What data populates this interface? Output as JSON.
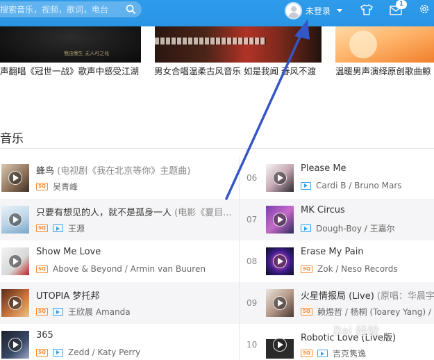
{
  "search": {
    "placeholder": "搜索音乐，视频，歌词，电台"
  },
  "user": {
    "login_label": "未登录"
  },
  "topbar": {
    "message_badge": "1",
    "icons": [
      "search-icon",
      "skin-icon",
      "mail-icon",
      "gear-icon"
    ]
  },
  "videos": [
    {
      "title": "声翻唱《冠世一战》歌声中感受江湖",
      "caption": "我由我生 无人可之化"
    },
    {
      "title": "男女合唱温柔古风音乐 如是我闻 春风不渡"
    },
    {
      "title": "温暖男声演绎原创歌曲鲸"
    }
  ],
  "section": {
    "title": "音乐"
  },
  "songs_left": [
    {
      "title": "蜂鸟",
      "note": "(电视剧《我在北京等你》主题曲)",
      "quality": "SQ",
      "has_mv": false,
      "artist": "吴青峰"
    },
    {
      "title": "只要有想见的人，就不是孤身一人",
      "note": "(电影《夏目...",
      "quality": "SQ",
      "has_mv": true,
      "artist": "王源"
    },
    {
      "title": "Show Me Love",
      "note": "",
      "quality": "SQ",
      "has_mv": false,
      "artist": "Above & Beyond / Armin van Buuren"
    },
    {
      "title": "UTOPIA 梦托邦",
      "note": "",
      "quality": "SQ",
      "has_mv": true,
      "artist": "王欣晨 Amanda"
    },
    {
      "title": "365",
      "note": "",
      "quality": "SQ",
      "has_mv": true,
      "artist": "Zedd / Katy Perry"
    }
  ],
  "songs_right": [
    {
      "rank": "06",
      "title": "Please Me",
      "note": "",
      "quality": "",
      "has_mv": true,
      "artist": "Cardi B / Bruno Mars"
    },
    {
      "rank": "07",
      "title": "MK Circus",
      "note": "",
      "quality": "",
      "has_mv": true,
      "artist": "Dough-Boy / 王嘉尔"
    },
    {
      "rank": "08",
      "title": "Erase My Pain",
      "note": "",
      "quality": "SQ",
      "has_mv": false,
      "artist": "Zok / Neso Records"
    },
    {
      "rank": "09",
      "title": "火星情报局 (Live)",
      "note": "(原唱：华晨宇)",
      "quality": "SQ",
      "has_mv": false,
      "artist": "赖煜哲 / 杨桐 (Toarey Yang) / 田"
    },
    {
      "rank": "10",
      "title": "Robotic Love (Live版)",
      "note": "",
      "quality": "SQ",
      "has_mv": true,
      "artist": "吉克隽逸"
    }
  ],
  "watermark": "Bai 经验",
  "colors": {
    "topbar": "#2a94e4",
    "sq_badge": "#ff8a2a",
    "mv_icon": "#31a2ef",
    "arrow": "#3556c6"
  }
}
